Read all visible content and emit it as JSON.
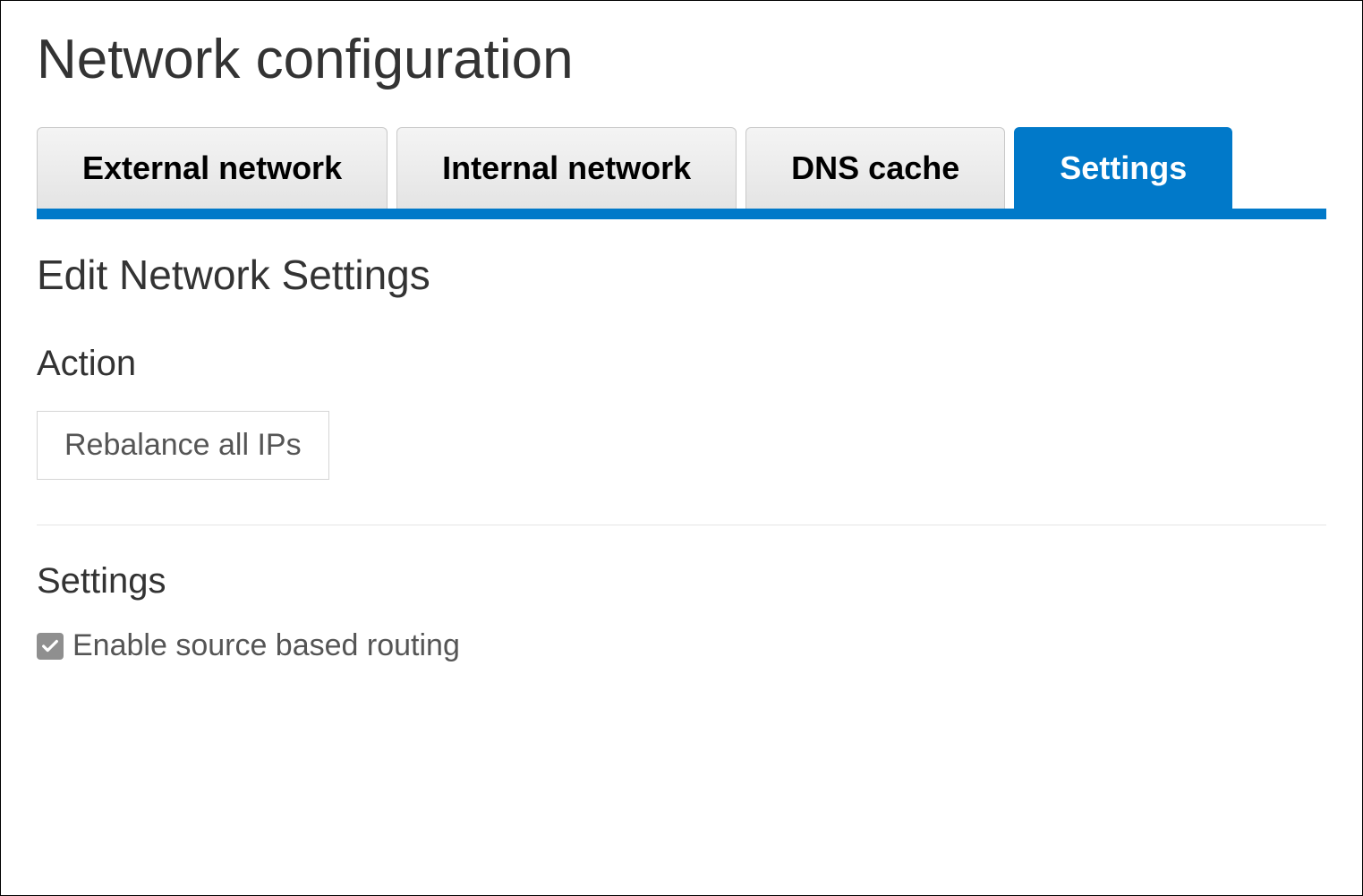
{
  "page": {
    "title": "Network configuration"
  },
  "tabs": [
    {
      "label": "External network",
      "active": false
    },
    {
      "label": "Internal network",
      "active": false
    },
    {
      "label": "DNS cache",
      "active": false
    },
    {
      "label": "Settings",
      "active": true
    }
  ],
  "content": {
    "section_title": "Edit Network Settings",
    "action": {
      "heading": "Action",
      "rebalance_button": "Rebalance all IPs"
    },
    "settings": {
      "heading": "Settings",
      "source_routing": {
        "label": "Enable source based routing",
        "checked": true
      }
    }
  }
}
